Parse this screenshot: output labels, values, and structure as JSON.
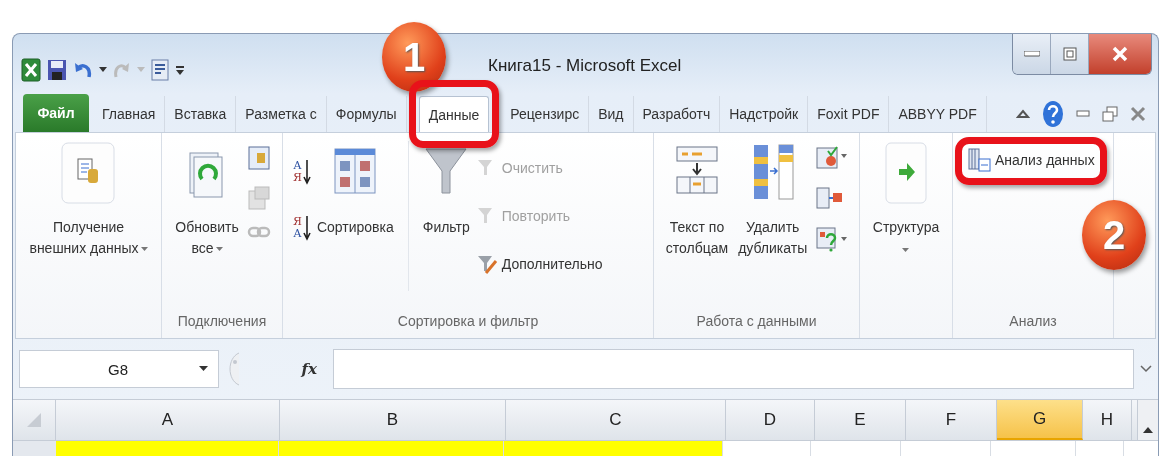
{
  "window": {
    "title": "Книга15 - Microsoft Excel"
  },
  "tabs": [
    {
      "label": "Файл",
      "kind": "file",
      "selected": false
    },
    {
      "label": "Главная",
      "kind": "tab",
      "selected": false
    },
    {
      "label": "Вставка",
      "kind": "tab",
      "selected": false
    },
    {
      "label": "Разметка с",
      "kind": "tab",
      "selected": false
    },
    {
      "label": "Формулы",
      "kind": "tab",
      "selected": false
    },
    {
      "label": "Данные",
      "kind": "tab",
      "selected": true
    },
    {
      "label": "Рецензирс",
      "kind": "tab",
      "selected": false
    },
    {
      "label": "Вид",
      "kind": "tab",
      "selected": false
    },
    {
      "label": "Разработч",
      "kind": "tab",
      "selected": false
    },
    {
      "label": "Надстройк",
      "kind": "tab",
      "selected": false
    },
    {
      "label": "Foxit PDF",
      "kind": "tab",
      "selected": false
    },
    {
      "label": "ABBYY PDF",
      "kind": "tab",
      "selected": false
    }
  ],
  "ribbon_groups": [
    {
      "items": [
        {
          "label": "Получение\nвнешних данных",
          "disabled": false
        }
      ]
    },
    {
      "label": "Подключения",
      "items": [
        {
          "label": "Обновить\nвсе",
          "disabled": false
        }
      ]
    },
    {
      "label": "Сортировка и фильтр",
      "sort_buttons": [
        {
          "letters": [
            "А",
            "Я"
          ]
        },
        {
          "letters": [
            "Я",
            "А"
          ]
        }
      ],
      "items": [
        {
          "label": "Сортировка",
          "disabled": false
        },
        {
          "label": "Фильтр",
          "disabled": false
        },
        {
          "label": "Очистить",
          "disabled": true
        },
        {
          "label": "Повторить",
          "disabled": true
        },
        {
          "label": "Дополнительно",
          "disabled": false
        }
      ]
    },
    {
      "label": "Работа с данными",
      "items": [
        {
          "label": "Текст по\nстолбцам",
          "disabled": false
        },
        {
          "label": "Удалить\nдубликаты",
          "disabled": false
        }
      ]
    },
    {
      "items": [
        {
          "label": "Структура",
          "disabled": false
        }
      ]
    },
    {
      "label": "Анализ",
      "items": [
        {
          "label": "Анализ данных",
          "disabled": false
        }
      ]
    }
  ],
  "formula_bar": {
    "name_box": "G8",
    "function_label": "fx"
  },
  "columns": [
    {
      "label": "A",
      "selected": false
    },
    {
      "label": "B",
      "selected": false
    },
    {
      "label": "C",
      "selected": false
    },
    {
      "label": "D",
      "selected": false
    },
    {
      "label": "E",
      "selected": false
    },
    {
      "label": "F",
      "selected": false
    },
    {
      "label": "G",
      "selected": true
    },
    {
      "label": "H",
      "selected": false
    }
  ],
  "cells": [
    {
      "color": "#ffff00"
    },
    {
      "color": "#ffff00"
    },
    {
      "color": "#ffff00"
    },
    {
      "color": "#ffffff"
    },
    {
      "color": "#ffffff"
    },
    {
      "color": "#ffffff"
    },
    {
      "color": "#ffffff"
    },
    {
      "color": "#ffffff"
    }
  ],
  "callouts": [
    {
      "label": "1"
    },
    {
      "label": "2"
    }
  ]
}
